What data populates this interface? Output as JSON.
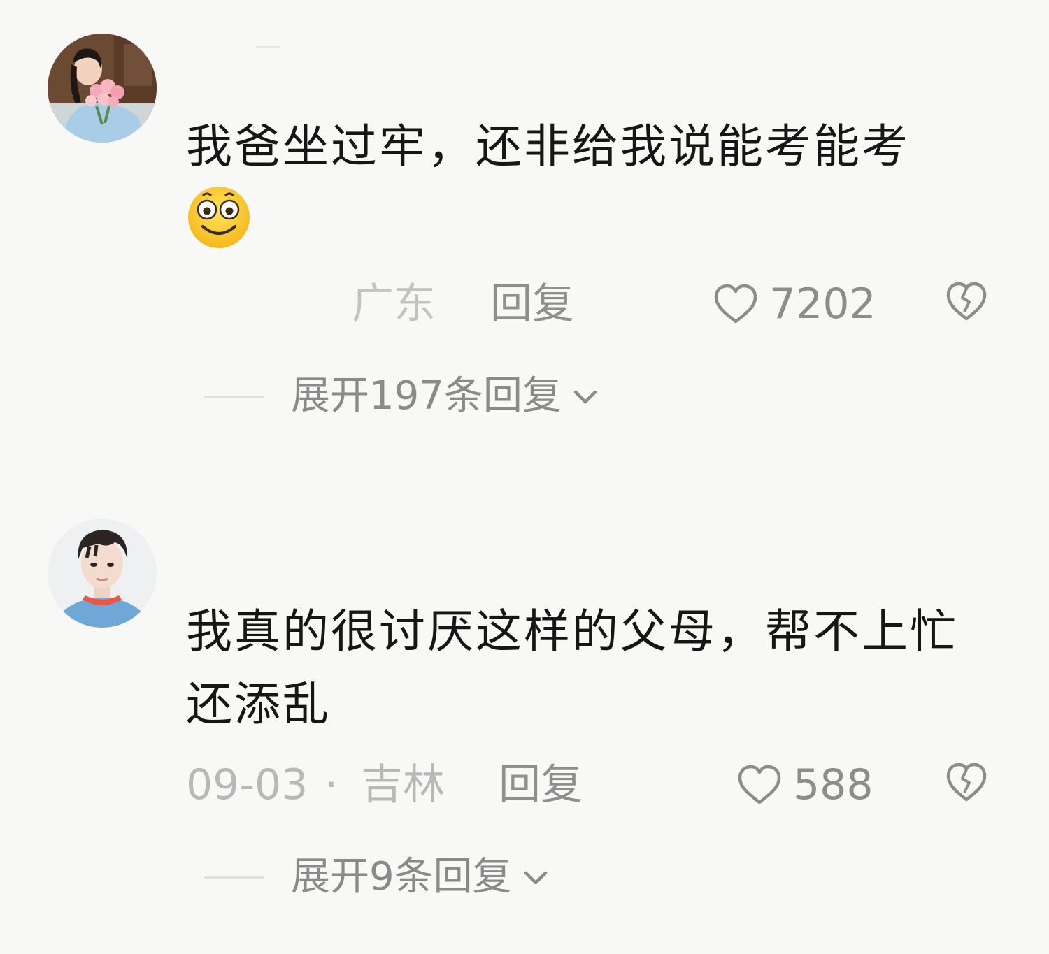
{
  "comments": [
    {
      "text": "我爸坐过牢，还非给我说能考能考",
      "emoji": "smiling-face-emoji",
      "date": "",
      "location": "广东",
      "reply_label": "回复",
      "likes": "7202",
      "expand_label": "展开197条回复",
      "avatar": "woman-holding-pink-flowers"
    },
    {
      "text": "我真的很讨厌这样的父母，帮不上忙还添乱",
      "date": "09-03",
      "separator": "·",
      "location": "吉林",
      "reply_label": "回复",
      "likes": "588",
      "expand_label": "展开9条回复",
      "avatar": "young-man-blue-shirt"
    }
  ],
  "icons": {
    "like": "heart-outline-icon",
    "dislike": "broken-heart-icon",
    "expand": "chevron-down-icon"
  },
  "colors": {
    "background": "#f8f8f6",
    "text": "#161616",
    "meta": "#b8b8b8",
    "secondary": "#8c8c8c"
  }
}
